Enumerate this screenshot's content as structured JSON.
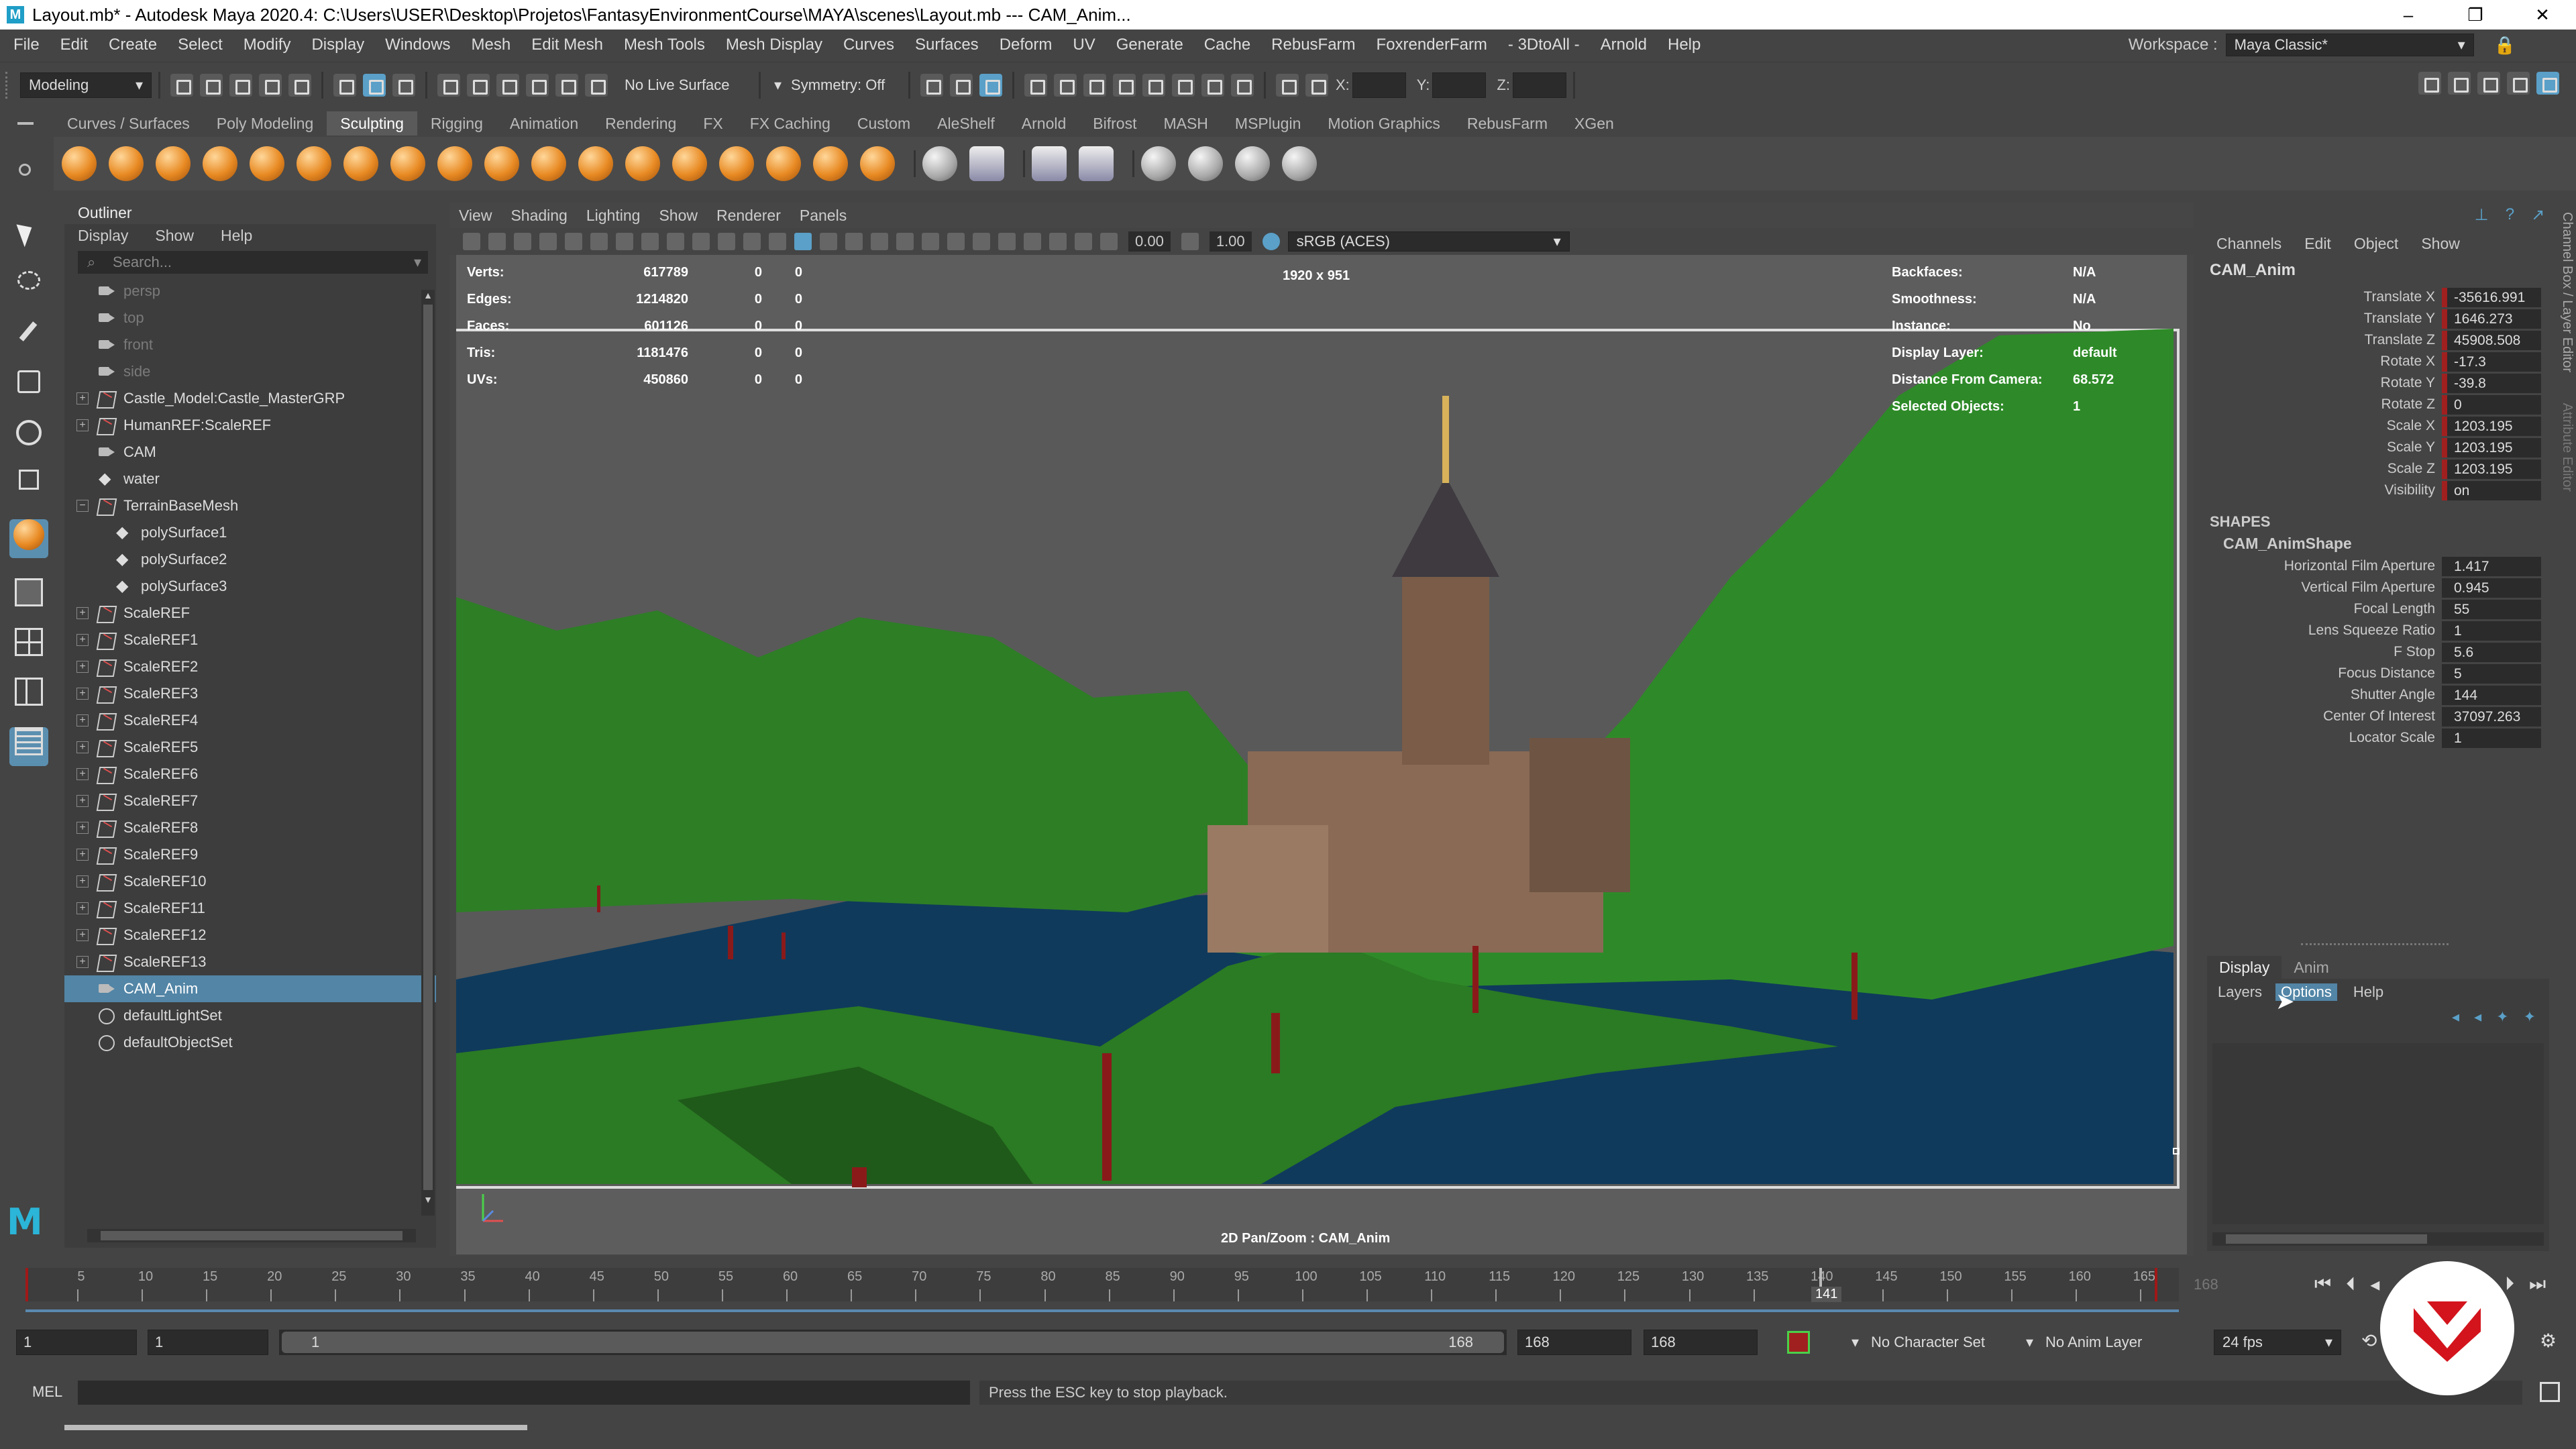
{
  "window": {
    "title": "Layout.mb* - Autodesk Maya 2020.4: C:\\Users\\USER\\Desktop\\Projetos\\FantasyEnvironmentCourse\\MAYA\\scenes\\Layout.mb   ---   CAM_Anim...",
    "buttons": {
      "minimize": "–",
      "maximize": "❐",
      "close": "✕"
    }
  },
  "menubar": {
    "items": [
      "File",
      "Edit",
      "Create",
      "Select",
      "Modify",
      "Display",
      "Windows",
      "Mesh",
      "Edit Mesh",
      "Mesh Tools",
      "Mesh Display",
      "Curves",
      "Surfaces",
      "Deform",
      "UV",
      "Generate",
      "Cache",
      "RebusFarm",
      "FoxrenderFarm",
      "- 3DtoAll -",
      "Arnold",
      "Help"
    ],
    "workspace_label": "Workspace :",
    "workspace_value": "Maya Classic*"
  },
  "statusline": {
    "mode": "Modeling",
    "live_surface": "No Live Surface",
    "symmetry": "Symmetry: Off",
    "x_label": "X:",
    "y_label": "Y:",
    "z_label": "Z:"
  },
  "shelf": {
    "tabs": [
      "Curves / Surfaces",
      "Poly Modeling",
      "Sculpting",
      "Rigging",
      "Animation",
      "Rendering",
      "FX",
      "FX Caching",
      "Custom",
      "AleShelf",
      "Arnold",
      "Bifrost",
      "MASH",
      "MSPlugin",
      "Motion Graphics",
      "RebusFarm",
      "XGen"
    ],
    "active_tab": "Sculpting"
  },
  "outliner": {
    "title": "Outliner",
    "menu": [
      "Display",
      "Show",
      "Help"
    ],
    "search_placeholder": "Search...",
    "items": [
      {
        "label": "persp",
        "type": "cam",
        "dim": true,
        "expand": "",
        "indent": 0
      },
      {
        "label": "top",
        "type": "cam",
        "dim": true,
        "expand": "",
        "indent": 0
      },
      {
        "label": "front",
        "type": "cam",
        "dim": true,
        "expand": "",
        "indent": 0
      },
      {
        "label": "side",
        "type": "cam",
        "dim": true,
        "expand": "",
        "indent": 0
      },
      {
        "label": "Castle_Model:Castle_MasterGRP",
        "type": "grp",
        "expand": "+",
        "indent": 0
      },
      {
        "label": "HumanREF:ScaleREF",
        "type": "grp",
        "expand": "+",
        "indent": 0
      },
      {
        "label": "CAM",
        "type": "cam",
        "expand": "",
        "indent": 0
      },
      {
        "label": "water",
        "type": "mesh",
        "expand": "",
        "indent": 0
      },
      {
        "label": "TerrainBaseMesh",
        "type": "grp",
        "expand": "−",
        "indent": 0
      },
      {
        "label": "polySurface1",
        "type": "mesh",
        "expand": "",
        "indent": 1
      },
      {
        "label": "polySurface2",
        "type": "mesh",
        "expand": "",
        "indent": 1
      },
      {
        "label": "polySurface3",
        "type": "mesh",
        "expand": "",
        "indent": 1
      },
      {
        "label": "ScaleREF",
        "type": "grp",
        "expand": "+",
        "indent": 0
      },
      {
        "label": "ScaleREF1",
        "type": "grp",
        "expand": "+",
        "indent": 0
      },
      {
        "label": "ScaleREF2",
        "type": "grp",
        "expand": "+",
        "indent": 0
      },
      {
        "label": "ScaleREF3",
        "type": "grp",
        "expand": "+",
        "indent": 0
      },
      {
        "label": "ScaleREF4",
        "type": "grp",
        "expand": "+",
        "indent": 0
      },
      {
        "label": "ScaleREF5",
        "type": "grp",
        "expand": "+",
        "indent": 0
      },
      {
        "label": "ScaleREF6",
        "type": "grp",
        "expand": "+",
        "indent": 0
      },
      {
        "label": "ScaleREF7",
        "type": "grp",
        "expand": "+",
        "indent": 0
      },
      {
        "label": "ScaleREF8",
        "type": "grp",
        "expand": "+",
        "indent": 0
      },
      {
        "label": "ScaleREF9",
        "type": "grp",
        "expand": "+",
        "indent": 0
      },
      {
        "label": "ScaleREF10",
        "type": "grp",
        "expand": "+",
        "indent": 0
      },
      {
        "label": "ScaleREF11",
        "type": "grp",
        "expand": "+",
        "indent": 0
      },
      {
        "label": "ScaleREF12",
        "type": "grp",
        "expand": "+",
        "indent": 0
      },
      {
        "label": "ScaleREF13",
        "type": "grp",
        "expand": "+",
        "indent": 0
      },
      {
        "label": "CAM_Anim",
        "type": "cam",
        "expand": "",
        "indent": 0,
        "selected": true
      },
      {
        "label": "defaultLightSet",
        "type": "set",
        "expand": "",
        "indent": 0
      },
      {
        "label": "defaultObjectSet",
        "type": "set",
        "expand": "",
        "indent": 0
      }
    ]
  },
  "viewport": {
    "menu": [
      "View",
      "Shading",
      "Lighting",
      "Show",
      "Renderer",
      "Panels"
    ],
    "exposure": "0.00",
    "gamma": "1.00",
    "colorspace": "sRGB (ACES)",
    "resolution": "1920 x 951",
    "camera_label": "2D Pan/Zoom : CAM_Anim",
    "hud_left": [
      {
        "label": "Verts:",
        "v1": "617789",
        "v2": "0",
        "v3": "0"
      },
      {
        "label": "Edges:",
        "v1": "1214820",
        "v2": "0",
        "v3": "0"
      },
      {
        "label": "Faces:",
        "v1": "601126",
        "v2": "0",
        "v3": "0"
      },
      {
        "label": "Tris:",
        "v1": "1181476",
        "v2": "0",
        "v3": "0"
      },
      {
        "label": "UVs:",
        "v1": "450860",
        "v2": "0",
        "v3": "0"
      }
    ],
    "hud_right": [
      {
        "label": "Backfaces:",
        "value": "N/A"
      },
      {
        "label": "Smoothness:",
        "value": "N/A"
      },
      {
        "label": "Instance:",
        "value": "No"
      },
      {
        "label": "Display Layer:",
        "value": "default"
      },
      {
        "label": "Distance From Camera:",
        "value": "68.572"
      },
      {
        "label": "Selected Objects:",
        "value": "1"
      }
    ],
    "colors": {
      "sky": "#5d5d5d",
      "water": "#0f3a5c",
      "terrain": "#2f8a2a",
      "castle": "#8a6a55"
    }
  },
  "channelbox": {
    "menu": [
      "Channels",
      "Edit",
      "Object",
      "Show"
    ],
    "object": "CAM_Anim",
    "channels": [
      {
        "label": "Translate X",
        "value": "-35616.991"
      },
      {
        "label": "Translate Y",
        "value": "1646.273"
      },
      {
        "label": "Translate Z",
        "value": "45908.508"
      },
      {
        "label": "Rotate X",
        "value": "-17.3"
      },
      {
        "label": "Rotate Y",
        "value": "-39.8"
      },
      {
        "label": "Rotate Z",
        "value": "0"
      },
      {
        "label": "Scale X",
        "value": "1203.195"
      },
      {
        "label": "Scale Y",
        "value": "1203.195"
      },
      {
        "label": "Scale Z",
        "value": "1203.195"
      },
      {
        "label": "Visibility",
        "value": "on"
      }
    ],
    "shapes_header": "SHAPES",
    "shape_name": "CAM_AnimShape",
    "shape_channels": [
      {
        "label": "Horizontal Film Aperture",
        "value": "1.417"
      },
      {
        "label": "Vertical Film Aperture",
        "value": "0.945"
      },
      {
        "label": "Focal Length",
        "value": "55"
      },
      {
        "label": "Lens Squeeze Ratio",
        "value": "1"
      },
      {
        "label": "F Stop",
        "value": "5.6"
      },
      {
        "label": "Focus Distance",
        "value": "5"
      },
      {
        "label": "Shutter Angle",
        "value": "144"
      },
      {
        "label": "Center Of Interest",
        "value": "37097.263"
      },
      {
        "label": "Locator Scale",
        "value": "1"
      }
    ],
    "side_tabs": [
      "Channel Box / Layer Editor",
      "Attribute Editor"
    ]
  },
  "layereditor": {
    "tabs": [
      "Display",
      "Anim"
    ],
    "menu": [
      "Layers",
      "Options",
      "Help"
    ]
  },
  "timeline": {
    "ticks": [
      "5",
      "10",
      "15",
      "20",
      "25",
      "30",
      "35",
      "40",
      "45",
      "50",
      "55",
      "60",
      "65",
      "70",
      "75",
      "80",
      "85",
      "90",
      "95",
      "100",
      "105",
      "110",
      "115",
      "120",
      "125",
      "130",
      "135",
      "140",
      "145",
      "150",
      "155",
      "160",
      "165"
    ],
    "current_frame": "141",
    "end_readout": "168",
    "range_start_outer": "1",
    "range_start_inner": "1",
    "range_slider_start": "1",
    "range_slider_end": "168",
    "range_end_inner": "168",
    "range_end_outer": "168",
    "character_set": "No Character Set",
    "anim_layer": "No Anim Layer",
    "fps": "24 fps"
  },
  "commandline": {
    "lang": "MEL",
    "help_text": "Press the ESC key to stop playback."
  }
}
